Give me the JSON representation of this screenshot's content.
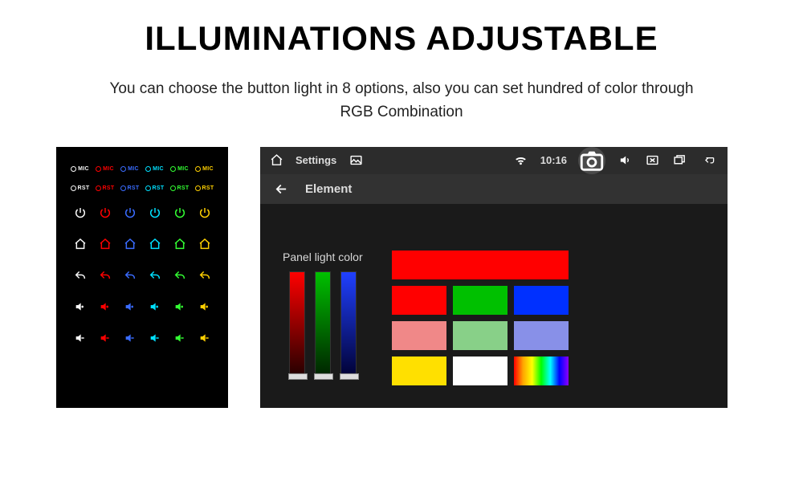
{
  "title": "ILLUMINATIONS ADJUSTABLE",
  "subtitle": "You can choose the button light in 8 options, also you can set hundred of color through RGB Combination",
  "left_panel": {
    "mic_label": "MIC",
    "rst_label": "RST",
    "colors": {
      "white": "#f8f8f8",
      "red": "#ff0000",
      "blue": "#3a6cff",
      "cyan": "#00e0ff",
      "green": "#33ff33",
      "yellow": "#ffd000"
    },
    "icon_rows": [
      "power",
      "home",
      "back",
      "vol-up",
      "vol-down"
    ]
  },
  "screen": {
    "statusbar": {
      "app_name": "Settings",
      "time": "10:16"
    },
    "subheader": {
      "title": "Element"
    },
    "content": {
      "label": "Panel light color",
      "big_swatch": "#ff0000",
      "swatches": [
        [
          "#ff0000",
          "#00c000",
          "#0030ff"
        ],
        [
          "#f08888",
          "#88d088",
          "#8890e8"
        ],
        [
          "#ffe000",
          "#ffffff",
          "rainbow"
        ]
      ]
    }
  }
}
